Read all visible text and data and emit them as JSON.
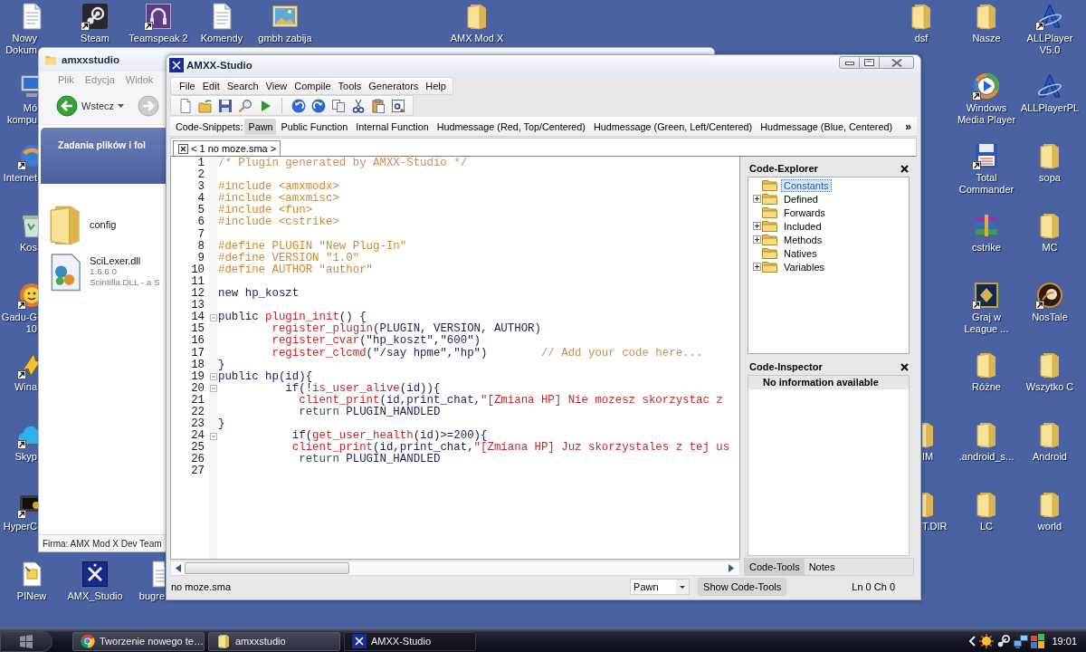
{
  "desktop": {
    "icons": [
      {
        "label": "Nowy Dokum",
        "kind": "text-file",
        "shortcut": false
      },
      {
        "label": "Steam",
        "kind": "steam",
        "shortcut": true
      },
      {
        "label": "Teamspeak 2",
        "kind": "headset",
        "shortcut": true
      },
      {
        "label": "Komendy",
        "kind": "text-file",
        "shortcut": false
      },
      {
        "label": "gmbh zabija",
        "kind": "image",
        "shortcut": false
      },
      {
        "label": "AMX Mod X",
        "kind": "folder",
        "shortcut": false
      },
      {
        "label": "dsf",
        "kind": "folder",
        "shortcut": false
      },
      {
        "label": "Nasze",
        "kind": "folder",
        "shortcut": false
      },
      {
        "label": "ALLPlayer V5.0",
        "kind": "player-a",
        "shortcut": true
      },
      {
        "label": "Mó kompu",
        "kind": "computer",
        "shortcut": false
      },
      {
        "label": "Windows Media Player",
        "kind": "media-player",
        "shortcut": true
      },
      {
        "label": "ALLPlayerPL",
        "kind": "player-a",
        "shortcut": false
      },
      {
        "label": "Internet",
        "kind": "browser",
        "shortcut": true
      },
      {
        "label": "Total Commander",
        "kind": "floppy",
        "shortcut": true
      },
      {
        "label": "sopa",
        "kind": "folder",
        "shortcut": false
      },
      {
        "label": "Kos",
        "kind": "recycle-bin",
        "shortcut": false
      },
      {
        "label": "cstrike",
        "kind": "archive",
        "shortcut": false
      },
      {
        "label": "MC",
        "kind": "folder",
        "shortcut": false
      },
      {
        "label": "Gadu-G 10",
        "kind": "sun",
        "shortcut": true
      },
      {
        "label": "Graj w League ...",
        "kind": "game-tile",
        "shortcut": true
      },
      {
        "label": "NosTale",
        "kind": "emblem",
        "shortcut": true
      },
      {
        "label": "Wina",
        "kind": "bolt",
        "shortcut": true
      },
      {
        "label": "Różne",
        "kind": "folder",
        "shortcut": false
      },
      {
        "label": "Wszytko C",
        "kind": "folder",
        "shortcut": false
      },
      {
        "label": "Skyp",
        "kind": "cloud",
        "shortcut": true
      },
      {
        "label": "IM",
        "kind": "folder",
        "shortcut": false
      },
      {
        "label": ".android_s...",
        "kind": "folder",
        "shortcut": false
      },
      {
        "label": "Android",
        "kind": "folder",
        "shortcut": false
      },
      {
        "label": "HyperC",
        "kind": "terminal",
        "shortcut": true
      },
      {
        "label": "T.DIR",
        "kind": "folder",
        "shortcut": false
      },
      {
        "label": "LC",
        "kind": "folder",
        "shortcut": false
      },
      {
        "label": "world",
        "kind": "folder",
        "shortcut": false
      },
      {
        "label": "PINew",
        "kind": "note",
        "shortcut": false
      },
      {
        "label": "AMX_Studio",
        "kind": "x-tile",
        "shortcut": false
      },
      {
        "label": "bugre",
        "kind": "text-file",
        "shortcut": false
      }
    ]
  },
  "explorer": {
    "title": "amxxstudio",
    "menu": [
      {
        "label": "Plik",
        "disabled": true
      },
      {
        "label": "Edycja",
        "disabled": true
      },
      {
        "label": "Widok",
        "disabled": true
      }
    ],
    "nav": [
      {
        "kind": "back",
        "label": "Wstecz",
        "disabled": false
      },
      {
        "kind": "forward",
        "disabled": true
      }
    ],
    "task_pane": {
      "title": "Zadania plików i fol"
    },
    "files": [
      {
        "name": "config",
        "kind": "folder"
      },
      {
        "name": "SciLexer.dll",
        "kind": "library",
        "details": [
          "1.6.6.0",
          "Scintilla.DLL - a S"
        ]
      }
    ],
    "status": "Firma: AMX Mod X Dev Team"
  },
  "studio": {
    "title": "AMXX-Studio",
    "menu": [
      "File",
      "Edit",
      "Search",
      "View",
      "Compile",
      "Tools",
      "Generators",
      "Help"
    ],
    "snippets": {
      "label": "Code-Snippets:",
      "items": [
        {
          "label": "Pawn",
          "selected": true
        },
        {
          "label": "Public Function",
          "selected": false
        },
        {
          "label": "Internal Function",
          "selected": false
        },
        {
          "label": "Hudmessage (Red, Top/Centered)",
          "selected": false
        },
        {
          "label": "Hudmessage (Green, Left/Centered)",
          "selected": false
        },
        {
          "label": "Hudmessage (Blue, Centered)",
          "selected": false
        }
      ],
      "more": "»"
    },
    "tabs": [
      {
        "label": "< 1 no moze.sma >",
        "selected": true
      }
    ],
    "editor": {
      "lines": [
        {
          "number": "1",
          "fold": false,
          "tokens": [
            {
              "kind": "comment",
              "text": "/* Plugin generated by AMXX-Studio */"
            }
          ]
        },
        {
          "number": "2",
          "fold": false
        },
        {
          "number": "3",
          "fold": false,
          "tokens": [
            {
              "kind": "preprocessor",
              "text": "#include <amxmodx>"
            }
          ]
        },
        {
          "number": "4",
          "fold": false,
          "tokens": [
            {
              "kind": "preprocessor",
              "text": "#include <amxmisc>"
            }
          ]
        },
        {
          "number": "5",
          "fold": false,
          "tokens": [
            {
              "kind": "preprocessor",
              "text": "#include <fun>"
            }
          ]
        },
        {
          "number": "6",
          "fold": false,
          "tokens": [
            {
              "kind": "preprocessor",
              "text": "#include <cstrike>"
            }
          ]
        },
        {
          "number": "7",
          "fold": false
        },
        {
          "number": "8",
          "fold": false,
          "tokens": [
            {
              "kind": "preprocessor",
              "text": "#define PLUGIN \"New Plug-In\""
            }
          ]
        },
        {
          "number": "9",
          "fold": false,
          "tokens": [
            {
              "kind": "preprocessor",
              "text": "#define VERSION \"1.0\""
            }
          ]
        },
        {
          "number": "10",
          "fold": false,
          "tokens": [
            {
              "kind": "preprocessor",
              "text": "#define AUTHOR \"author\""
            }
          ]
        },
        {
          "number": "11",
          "fold": false
        },
        {
          "number": "12",
          "fold": false,
          "tokens": [
            {
              "kind": "plain",
              "text": "new hp_koszt"
            }
          ]
        },
        {
          "number": "13",
          "fold": false
        },
        {
          "number": "14",
          "fold": true,
          "tokens": [
            {
              "kind": "plain",
              "text": "public "
            },
            {
              "kind": "function",
              "text": "plugin_init"
            },
            {
              "kind": "plain",
              "text": "() {"
            }
          ]
        },
        {
          "number": "15",
          "fold": false,
          "tokens": [
            {
              "kind": "function",
              "text": "        register_plugin"
            },
            {
              "kind": "plain",
              "text": "(PLUGIN, VERSION, AUTHOR)"
            }
          ]
        },
        {
          "number": "16",
          "fold": false,
          "tokens": [
            {
              "kind": "function",
              "text": "        register_cvar"
            },
            {
              "kind": "plain",
              "text": "(\"hp_koszt\",\"600\")"
            }
          ]
        },
        {
          "number": "17",
          "fold": false,
          "tokens": [
            {
              "kind": "function",
              "text": "        register_clcmd"
            },
            {
              "kind": "plain",
              "text": "(\"/say hpme\",\"hp\")"
            },
            {
              "kind": "comment",
              "text": "        // Add your code here..."
            }
          ]
        },
        {
          "number": "18",
          "fold": false,
          "tokens": [
            {
              "kind": "plain",
              "text": "}"
            }
          ]
        },
        {
          "number": "19",
          "fold": true,
          "tokens": [
            {
              "kind": "plain",
              "text": "public hp(id){"
            }
          ]
        },
        {
          "number": "20",
          "fold": true,
          "tokens": [
            {
              "kind": "plain",
              "text": "          if(!"
            },
            {
              "kind": "function",
              "text": "is_user_alive"
            },
            {
              "kind": "plain",
              "text": "(id)){"
            }
          ]
        },
        {
          "number": "21",
          "fold": false,
          "tokens": [
            {
              "kind": "function",
              "text": "            client_print"
            },
            {
              "kind": "plain",
              "text": "(id,print_chat,"
            },
            {
              "kind": "string",
              "text": "\"[Zmiana HP] Nie mozesz skorzystac z"
            }
          ]
        },
        {
          "number": "22",
          "fold": false,
          "tokens": [
            {
              "kind": "keyword",
              "text": "            return"
            },
            {
              "kind": "plain",
              "text": " PLUGIN_HANDLED"
            }
          ]
        },
        {
          "number": "23",
          "fold": false,
          "tokens": [
            {
              "kind": "plain",
              "text": "}"
            }
          ]
        },
        {
          "number": "24",
          "fold": true,
          "tokens": [
            {
              "kind": "plain",
              "text": "           if("
            },
            {
              "kind": "function",
              "text": "get_user_health"
            },
            {
              "kind": "plain",
              "text": "(id)>=200){"
            }
          ]
        },
        {
          "number": "25",
          "fold": false,
          "tokens": [
            {
              "kind": "function",
              "text": "           client_print"
            },
            {
              "kind": "plain",
              "text": "(id,print_chat,"
            },
            {
              "kind": "string",
              "text": "\"[Zmiana HP] Juz skorzystales z tej us"
            }
          ]
        },
        {
          "number": "26",
          "fold": false,
          "tokens": [
            {
              "kind": "keyword",
              "text": "            return"
            },
            {
              "kind": "plain",
              "text": " PLUGIN_HANDLED"
            }
          ]
        },
        {
          "number": "27",
          "fold": false
        }
      ]
    },
    "code_explorer": {
      "title": "Code-Explorer",
      "items": [
        {
          "label": "Constants",
          "expandable": false,
          "selected": true
        },
        {
          "label": "Defined",
          "expandable": true,
          "selected": false
        },
        {
          "label": "Forwards",
          "expandable": false,
          "selected": false
        },
        {
          "label": "Included",
          "expandable": true,
          "selected": false
        },
        {
          "label": "Methods",
          "expandable": true,
          "selected": false
        },
        {
          "label": "Natives",
          "expandable": false,
          "selected": false
        },
        {
          "label": "Variables",
          "expandable": true,
          "selected": false
        }
      ]
    },
    "code_inspector": {
      "title": "Code-Inspector",
      "message": "No information available"
    },
    "panel_tabs": [
      {
        "label": "Code-Tools",
        "selected": true
      },
      {
        "label": "Notes",
        "selected": false
      }
    ],
    "status_bar": {
      "file": "no moze.sma",
      "language": "Pawn",
      "button": "Show Code-Tools",
      "position": "Ln 0 Ch 0"
    }
  },
  "taskbar": {
    "tasks": [
      {
        "label": "Tworzenie nowego te…",
        "kind": "browser",
        "selected": false
      },
      {
        "label": "amxxstudio",
        "kind": "folder",
        "selected": false
      },
      {
        "label": "AMXX-Studio",
        "kind": "amxx",
        "selected": true
      }
    ],
    "clock": "19:01"
  }
}
